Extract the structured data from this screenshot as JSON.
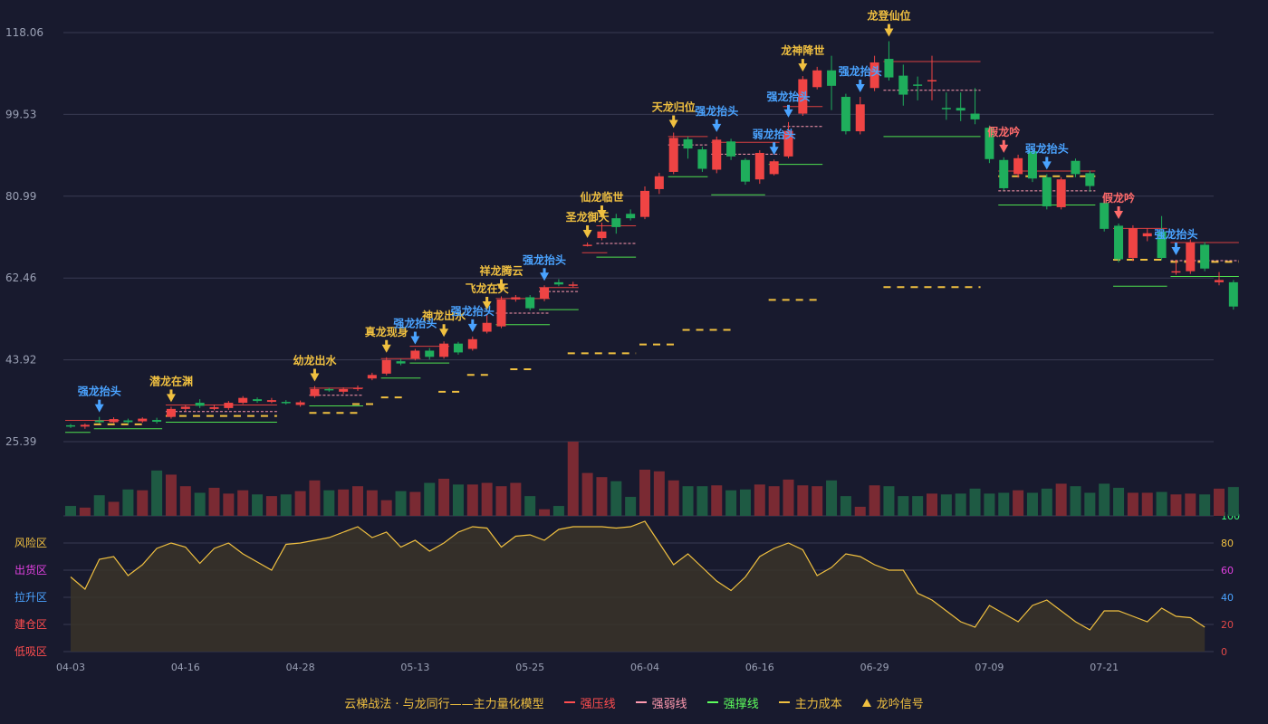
{
  "chart_data": {
    "type": "candlestick",
    "price_axis": {
      "ticks": [
        118.06,
        99.53,
        80.99,
        62.46,
        43.92,
        25.39
      ],
      "range": [
        25.39,
        118.06
      ]
    },
    "osc_axis": {
      "ticks": [
        0,
        20,
        40,
        60,
        80,
        100
      ],
      "range": [
        0,
        100
      ],
      "zones": [
        {
          "label": "风险区",
          "value": 80,
          "color": "#f0c040"
        },
        {
          "label": "出货区",
          "value": 60,
          "color": "#e040e0"
        },
        {
          "label": "拉升区",
          "value": 40,
          "color": "#4aa3ff"
        },
        {
          "label": "建仓区",
          "value": 20,
          "color": "#ff4d4f"
        },
        {
          "label": "低吸区",
          "value": 0,
          "color": "#ff4d4f"
        }
      ]
    },
    "x_ticks": [
      {
        "i": 0,
        "label": "04-03"
      },
      {
        "i": 8,
        "label": "04-16"
      },
      {
        "i": 16,
        "label": "04-28"
      },
      {
        "i": 24,
        "label": "05-13"
      },
      {
        "i": 32,
        "label": "05-25"
      },
      {
        "i": 40,
        "label": "06-04"
      },
      {
        "i": 48,
        "label": "06-16"
      },
      {
        "i": 56,
        "label": "06-29"
      },
      {
        "i": 64,
        "label": "07-09"
      },
      {
        "i": 72,
        "label": "07-21"
      }
    ],
    "candles": [
      [
        29.1,
        28.8,
        29.4,
        28.5
      ],
      [
        28.8,
        29.2,
        29.5,
        28.3
      ],
      [
        30.2,
        29.8,
        31.0,
        29.5
      ],
      [
        29.8,
        30.5,
        30.9,
        29.6
      ],
      [
        30.2,
        29.8,
        30.6,
        29.4
      ],
      [
        30.0,
        30.6,
        30.9,
        29.7
      ],
      [
        30.3,
        29.9,
        30.8,
        29.5
      ],
      [
        31.0,
        32.8,
        33.3,
        30.6
      ],
      [
        32.8,
        33.3,
        33.7,
        32.3
      ],
      [
        34.2,
        33.5,
        35.0,
        33.0
      ],
      [
        32.8,
        33.2,
        33.8,
        32.5
      ],
      [
        33.0,
        34.2,
        34.6,
        32.6
      ],
      [
        34.2,
        35.3,
        35.7,
        33.9
      ],
      [
        35.0,
        34.6,
        35.4,
        34.2
      ],
      [
        34.4,
        34.8,
        35.3,
        34.1
      ],
      [
        34.4,
        34.1,
        34.8,
        33.8
      ],
      [
        33.7,
        34.3,
        34.7,
        33.3
      ],
      [
        35.7,
        37.3,
        38.0,
        35.3
      ],
      [
        37.3,
        37.0,
        37.6,
        36.7
      ],
      [
        36.7,
        37.3,
        37.7,
        36.2
      ],
      [
        37.3,
        37.6,
        38.1,
        36.9
      ],
      [
        39.7,
        40.5,
        41.0,
        39.3
      ],
      [
        40.8,
        43.9,
        44.5,
        40.4
      ],
      [
        43.6,
        43.1,
        44.1,
        42.7
      ],
      [
        44.2,
        46.0,
        46.4,
        43.8
      ],
      [
        46.0,
        44.6,
        46.6,
        44.0
      ],
      [
        44.6,
        47.6,
        48.1,
        44.2
      ],
      [
        47.6,
        45.6,
        48.0,
        45.1
      ],
      [
        46.4,
        48.6,
        49.2,
        46.0
      ],
      [
        50.3,
        52.3,
        54.3,
        49.9
      ],
      [
        51.5,
        57.6,
        58.3,
        51.1
      ],
      [
        57.6,
        58.1,
        58.6,
        57.1
      ],
      [
        58.1,
        55.6,
        58.6,
        55.1
      ],
      [
        57.8,
        60.3,
        60.8,
        57.2
      ],
      [
        61.5,
        61.0,
        62.2,
        60.6
      ],
      [
        61.0,
        61.0,
        61.6,
        60.3
      ],
      [
        70.0,
        70.0,
        70.5,
        69.6
      ],
      [
        71.5,
        73.0,
        75.0,
        71.0
      ],
      [
        76.0,
        74.0,
        77.0,
        72.5
      ],
      [
        77.0,
        76.0,
        78.0,
        75.5
      ],
      [
        76.3,
        82.2,
        83.2,
        75.8
      ],
      [
        82.6,
        85.5,
        86.3,
        81.5
      ],
      [
        86.5,
        94.2,
        95.4,
        86.0
      ],
      [
        93.9,
        91.8,
        94.5,
        89.5
      ],
      [
        91.6,
        87.2,
        92.2,
        86.5
      ],
      [
        87.0,
        93.8,
        94.5,
        86.2
      ],
      [
        93.4,
        90.0,
        94.0,
        89.2
      ],
      [
        89.2,
        84.3,
        89.6,
        83.6
      ],
      [
        84.8,
        90.8,
        91.4,
        83.8
      ],
      [
        86.0,
        88.9,
        89.3,
        85.7
      ],
      [
        90.0,
        95.8,
        97.8,
        89.6
      ],
      [
        99.7,
        107.5,
        108.2,
        99.2
      ],
      [
        105.7,
        109.5,
        110.3,
        105.2
      ],
      [
        109.5,
        106.0,
        112.8,
        100.5
      ],
      [
        103.5,
        95.7,
        104.2,
        95.0
      ],
      [
        95.7,
        101.8,
        103.5,
        95.0
      ],
      [
        105.5,
        111.3,
        112.8,
        104.8
      ],
      [
        112.1,
        107.9,
        116.1,
        107.2
      ],
      [
        108.3,
        104.0,
        110.8,
        101.5
      ],
      [
        106.3,
        106.1,
        108.1,
        102.7
      ],
      [
        107.3,
        107.3,
        112.8,
        102.7
      ],
      [
        101.0,
        100.9,
        104.5,
        98.3
      ],
      [
        101.0,
        100.4,
        104.5,
        98.0
      ],
      [
        99.7,
        98.4,
        105.5,
        97.3
      ],
      [
        96.5,
        89.4,
        97.0,
        88.5
      ],
      [
        89.2,
        82.8,
        89.8,
        82.3
      ],
      [
        86.0,
        89.6,
        90.4,
        85.2
      ],
      [
        91.2,
        85.0,
        91.7,
        84.2
      ],
      [
        85.3,
        78.7,
        86.0,
        78.0
      ],
      [
        78.5,
        84.8,
        85.3,
        78.0
      ],
      [
        89.0,
        86.0,
        89.5,
        85.3
      ],
      [
        86.2,
        83.3,
        86.8,
        82.0
      ],
      [
        79.5,
        73.6,
        80.0,
        73.0
      ],
      [
        74.3,
        66.7,
        74.8,
        66.0
      ],
      [
        67.0,
        73.7,
        74.4,
        66.3
      ],
      [
        71.9,
        72.6,
        73.7,
        70.8
      ],
      [
        73.0,
        67.0,
        76.5,
        66.5
      ],
      [
        64.0,
        64.0,
        66.6,
        63.2
      ],
      [
        64.0,
        70.5,
        71.2,
        63.4
      ],
      [
        70.0,
        64.6,
        70.6,
        64.0
      ],
      [
        61.5,
        62.0,
        63.8,
        60.8
      ],
      [
        61.5,
        56.0,
        62.0,
        55.3
      ]
    ],
    "volume": [
      12,
      10,
      25,
      17,
      32,
      31,
      55,
      50,
      36,
      28,
      34,
      27,
      31,
      26,
      24,
      26,
      30,
      43,
      31,
      32,
      36,
      31,
      19,
      30,
      29,
      40,
      45,
      38,
      38,
      40,
      36,
      40,
      24,
      8,
      12,
      90,
      52,
      47,
      42,
      23,
      56,
      54,
      43,
      36,
      36,
      37,
      31,
      32,
      38,
      36,
      44,
      37,
      36,
      43,
      24,
      11,
      37,
      36,
      24,
      24,
      27,
      26,
      27,
      33,
      27,
      28,
      31,
      28,
      33,
      39,
      36,
      28,
      39,
      34,
      28,
      28,
      29,
      26,
      27,
      26,
      33,
      35
    ],
    "oscillator": [
      55,
      46,
      68,
      70,
      56,
      64,
      76,
      80,
      77,
      65,
      76,
      80,
      72,
      66,
      60,
      79,
      80,
      82,
      84,
      88,
      92,
      84,
      88,
      77,
      82,
      74,
      80,
      88,
      92,
      91,
      77,
      85,
      86,
      82,
      90,
      92,
      92,
      92,
      91,
      92,
      96,
      80,
      64,
      72,
      62,
      52,
      45,
      55,
      70,
      76,
      80,
      75,
      56,
      62,
      72,
      70,
      64,
      60,
      60,
      43,
      38,
      30,
      22,
      18,
      34,
      28,
      22,
      34,
      38,
      30,
      22,
      16,
      30,
      30,
      26,
      22,
      32,
      26,
      25,
      18
    ],
    "signals": [
      {
        "i": 2,
        "label": "强龙抬头",
        "color": "#4aa3ff",
        "arrow": "down"
      },
      {
        "i": 7,
        "label": "潜龙在渊",
        "color": "#f0c040",
        "arrow": "down"
      },
      {
        "i": 17,
        "label": "幼龙出水",
        "color": "#f0c040",
        "arrow": "down"
      },
      {
        "i": 22,
        "label": "真龙现身",
        "color": "#f0c040",
        "arrow": "down"
      },
      {
        "i": 24,
        "label": "强龙抬头",
        "color": "#4aa3ff",
        "arrow": "down"
      },
      {
        "i": 26,
        "label": "神龙出水",
        "color": "#f0c040",
        "arrow": "down"
      },
      {
        "i": 28,
        "label": "强龙抬头",
        "color": "#4aa3ff",
        "arrow": "down"
      },
      {
        "i": 29,
        "label": "飞龙在天",
        "color": "#f0c040",
        "arrow": "down"
      },
      {
        "i": 30,
        "label": "祥龙腾云",
        "color": "#f0c040",
        "arrow": "down"
      },
      {
        "i": 33,
        "label": "强龙抬头",
        "color": "#4aa3ff",
        "arrow": "down"
      },
      {
        "i": 36,
        "label": "圣龙御天",
        "color": "#f0c040",
        "arrow": "down"
      },
      {
        "i": 37,
        "label": "仙龙临世",
        "color": "#f0c040",
        "arrow": "down"
      },
      {
        "i": 42,
        "label": "天龙归位",
        "color": "#f0c040",
        "arrow": "down"
      },
      {
        "i": 45,
        "label": "强龙抬头",
        "color": "#4aa3ff",
        "arrow": "down"
      },
      {
        "i": 49,
        "label": "弱龙抬头",
        "color": "#4aa3ff",
        "arrow": "down"
      },
      {
        "i": 50,
        "label": "强龙抬头",
        "color": "#4aa3ff",
        "arrow": "down"
      },
      {
        "i": 51,
        "label": "龙神降世",
        "color": "#f0c040",
        "arrow": "down"
      },
      {
        "i": 55,
        "label": "强龙抬头",
        "color": "#4aa3ff",
        "arrow": "down"
      },
      {
        "i": 57,
        "label": "龙登仙位",
        "color": "#f0c040",
        "arrow": "down"
      },
      {
        "i": 65,
        "label": "假龙吟",
        "color": "#ff6b6b",
        "arrow": "down"
      },
      {
        "i": 68,
        "label": "弱龙抬头",
        "color": "#4aa3ff",
        "arrow": "down"
      },
      {
        "i": 73,
        "label": "假龙吟",
        "color": "#ff6b6b",
        "arrow": "down"
      },
      {
        "i": 77,
        "label": "强龙抬头",
        "color": "#4aa3ff",
        "arrow": "down"
      }
    ],
    "levels": [
      {
        "kind": "resist",
        "from": 0,
        "to": 3,
        "value": 30.2
      },
      {
        "kind": "support",
        "from": 0,
        "to": 1,
        "value": 27.5
      },
      {
        "kind": "support",
        "from": 2,
        "to": 6,
        "value": 28.3
      },
      {
        "kind": "cost",
        "from": 2,
        "to": 5,
        "value": 29.3
      },
      {
        "kind": "resist",
        "from": 7,
        "to": 14,
        "value": 33.7
      },
      {
        "kind": "weak",
        "from": 7,
        "to": 14,
        "value": 32.2
      },
      {
        "kind": "support",
        "from": 7,
        "to": 14,
        "value": 29.8
      },
      {
        "kind": "cost",
        "from": 7,
        "to": 14,
        "value": 31.2
      },
      {
        "kind": "resist",
        "from": 17,
        "to": 20,
        "value": 37.5
      },
      {
        "kind": "weak",
        "from": 17,
        "to": 20,
        "value": 35.9
      },
      {
        "kind": "support",
        "from": 17,
        "to": 20,
        "value": 33.5
      },
      {
        "kind": "cost",
        "from": 17,
        "to": 20,
        "value": 31.9
      },
      {
        "kind": "cost",
        "from": 20,
        "to": 21,
        "value": 33.9
      },
      {
        "kind": "resist",
        "from": 22,
        "to": 24,
        "value": 44.2
      },
      {
        "kind": "support",
        "from": 22,
        "to": 24,
        "value": 39.8
      },
      {
        "kind": "cost",
        "from": 22,
        "to": 23,
        "value": 35.4
      },
      {
        "kind": "resist",
        "from": 24,
        "to": 26,
        "value": 47.0
      },
      {
        "kind": "support",
        "from": 24,
        "to": 26,
        "value": 43.2
      },
      {
        "kind": "cost",
        "from": 26,
        "to": 27,
        "value": 36.7
      },
      {
        "kind": "resist",
        "from": 30,
        "to": 33,
        "value": 57.8
      },
      {
        "kind": "weak",
        "from": 30,
        "to": 33,
        "value": 54.5
      },
      {
        "kind": "support",
        "from": 30,
        "to": 33,
        "value": 51.9
      },
      {
        "kind": "cost",
        "from": 28,
        "to": 29,
        "value": 40.5
      },
      {
        "kind": "resist",
        "from": 33,
        "to": 35,
        "value": 60.3
      },
      {
        "kind": "weak",
        "from": 33,
        "to": 35,
        "value": 59.4
      },
      {
        "kind": "support",
        "from": 33,
        "to": 35,
        "value": 55.3
      },
      {
        "kind": "cost",
        "from": 31,
        "to": 32,
        "value": 41.8
      },
      {
        "kind": "resist",
        "from": 36,
        "to": 37,
        "value": 68.2
      },
      {
        "kind": "resist",
        "from": 37,
        "to": 39,
        "value": 74.3
      },
      {
        "kind": "weak",
        "from": 37,
        "to": 39,
        "value": 70.3
      },
      {
        "kind": "support",
        "from": 37,
        "to": 39,
        "value": 67.2
      },
      {
        "kind": "cost",
        "from": 35,
        "to": 39,
        "value": 45.4
      },
      {
        "kind": "resist",
        "from": 42,
        "to": 44,
        "value": 94.5
      },
      {
        "kind": "weak",
        "from": 42,
        "to": 44,
        "value": 92.6
      },
      {
        "kind": "support",
        "from": 42,
        "to": 44,
        "value": 85.4
      },
      {
        "kind": "cost",
        "from": 40,
        "to": 42,
        "value": 47.4
      },
      {
        "kind": "resist",
        "from": 45,
        "to": 49,
        "value": 93.2
      },
      {
        "kind": "weak",
        "from": 45,
        "to": 49,
        "value": 90.5
      },
      {
        "kind": "support",
        "from": 45,
        "to": 48,
        "value": 81.3
      },
      {
        "kind": "cost",
        "from": 43,
        "to": 46,
        "value": 50.7
      },
      {
        "kind": "resist",
        "from": 50,
        "to": 52,
        "value": 101.3
      },
      {
        "kind": "weak",
        "from": 50,
        "to": 52,
        "value": 96.8
      },
      {
        "kind": "support",
        "from": 49,
        "to": 52,
        "value": 88.2
      },
      {
        "kind": "cost",
        "from": 49,
        "to": 52,
        "value": 57.5
      },
      {
        "kind": "resist",
        "from": 57,
        "to": 63,
        "value": 111.5
      },
      {
        "kind": "weak",
        "from": 57,
        "to": 63,
        "value": 105.0
      },
      {
        "kind": "support",
        "from": 57,
        "to": 63,
        "value": 94.5
      },
      {
        "kind": "cost",
        "from": 57,
        "to": 63,
        "value": 60.4
      },
      {
        "kind": "resist",
        "from": 65,
        "to": 71,
        "value": 86.7
      },
      {
        "kind": "weak",
        "from": 65,
        "to": 71,
        "value": 82.2
      },
      {
        "kind": "support",
        "from": 65,
        "to": 71,
        "value": 79.0
      },
      {
        "kind": "cost",
        "from": 65,
        "to": 71,
        "value": 85.5
      },
      {
        "kind": "resist",
        "from": 73,
        "to": 76,
        "value": 73.7
      },
      {
        "kind": "support",
        "from": 73,
        "to": 76,
        "value": 60.6
      },
      {
        "kind": "cost",
        "from": 73,
        "to": 76,
        "value": 66.6
      },
      {
        "kind": "resist",
        "from": 77,
        "to": 81,
        "value": 70.5
      },
      {
        "kind": "weak",
        "from": 77,
        "to": 81,
        "value": 66.4
      },
      {
        "kind": "support",
        "from": 77,
        "to": 81,
        "value": 62.8
      },
      {
        "kind": "cost",
        "from": 77,
        "to": 81,
        "value": 66.1
      }
    ]
  },
  "legend": {
    "title": "云梯战法 · 与龙同行——主力量化模型",
    "items": [
      {
        "label": "强压线",
        "color": "#ff4d4f",
        "style": "solid"
      },
      {
        "label": "强弱线",
        "color": "#ff9ab0",
        "style": "dash"
      },
      {
        "label": "强撑线",
        "color": "#5dff5d",
        "style": "solid"
      },
      {
        "label": "主力成本",
        "color": "#f0c040",
        "style": "dash"
      },
      {
        "label": "龙吟信号",
        "color": "#f0c040",
        "style": "triangle"
      }
    ]
  },
  "colors": {
    "up": "#ef4444",
    "down": "#1fae5c",
    "vol_up": "#7a2a33",
    "vol_down": "#1e5a43",
    "grid": "#393b52",
    "axis_text": "#9aa0b4",
    "osc_line": "#f0c040",
    "osc_fill": "#3a3428"
  }
}
